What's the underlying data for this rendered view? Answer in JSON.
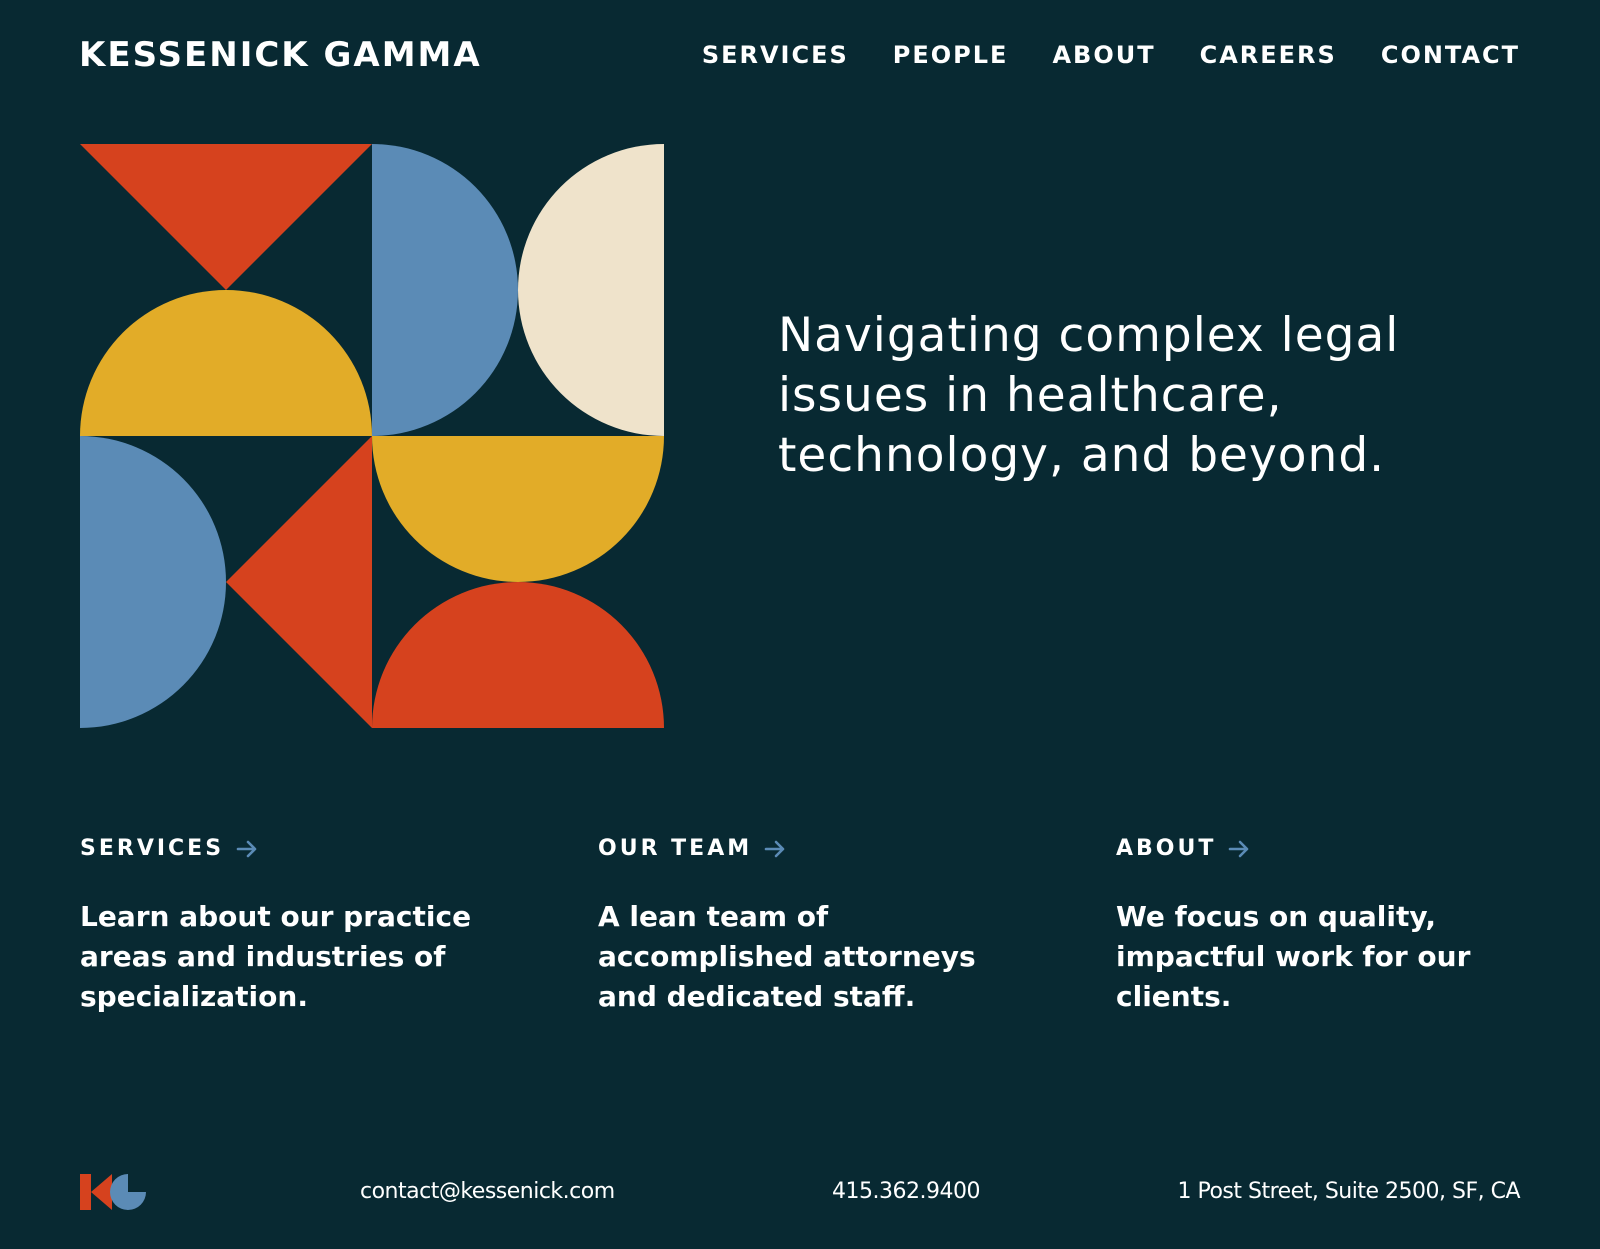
{
  "brand": {
    "name": "KESSENICK GAMMA"
  },
  "nav": {
    "items": [
      "SERVICES",
      "PEOPLE",
      "ABOUT",
      "CAREERS",
      "CONTACT"
    ]
  },
  "hero": {
    "tagline": "Navigating complex legal issues in healthcare, technology, and beyond."
  },
  "columns": [
    {
      "label": "SERVICES",
      "body": "Learn about our practice areas and industries of specialization."
    },
    {
      "label": "OUR TEAM",
      "body": "A lean team of accomplished attorneys and dedicated staff."
    },
    {
      "label": "ABOUT",
      "body": "We focus on quality, impactful work for our clients."
    }
  ],
  "footer": {
    "email": "contact@kessenick.com",
    "phone": "415.362.9400",
    "address": "1 Post Street, Suite 2500, SF, CA"
  },
  "colors": {
    "background": "#082932",
    "red": "#D6421E",
    "blue": "#5B8BB6",
    "yellow": "#E2AC28",
    "cream": "#EFE3CB",
    "text": "#FFFFFF"
  },
  "icons": {
    "arrow": "arrow-right-icon",
    "logo": "kg-logo-icon"
  }
}
